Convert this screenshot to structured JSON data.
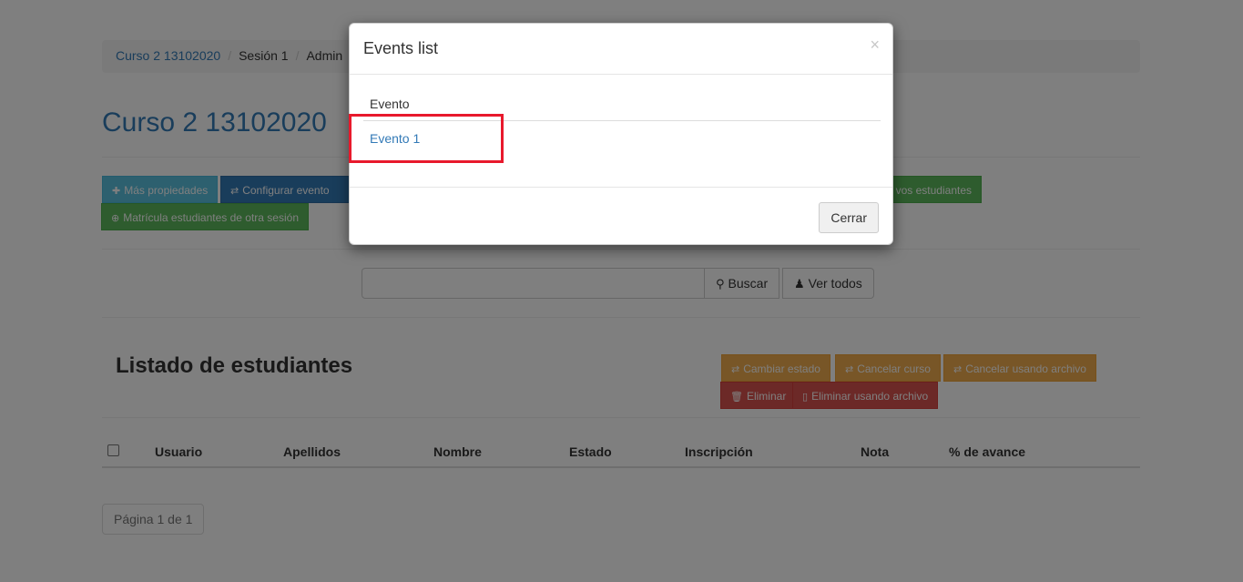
{
  "breadcrumb": {
    "course": "Curso 2 13102020",
    "session": "Sesión 1",
    "admin": "Admin"
  },
  "page_title": "Curso 2 13102020",
  "toolbar": {
    "more_props": "Más propiedades",
    "config_event": "Configurar evento",
    "new_students": "vos estudiantes",
    "enroll_other": "Matrícula estudiantes de otra sesión"
  },
  "search": {
    "value": "",
    "search_label": "Buscar",
    "view_all_label": "Ver todos"
  },
  "students": {
    "title": "Listado de estudiantes",
    "actions": {
      "change_state": "Cambiar estado",
      "cancel_course": "Cancelar curso",
      "cancel_file": "Cancelar usando archivo",
      "delete": "Eliminar",
      "delete_file": "Eliminar usando archivo"
    },
    "columns": [
      "Usuario",
      "Apellidos",
      "Nombre",
      "Estado",
      "Inscripción",
      "Nota",
      "% de avance"
    ],
    "pager": "Página 1 de 1"
  },
  "modal": {
    "title": "Events list",
    "close_symbol": "×",
    "column_header": "Evento",
    "events": [
      "Evento 1"
    ],
    "close_button": "Cerrar"
  },
  "colors": {
    "link": "#337ab7",
    "highlight": "#e8192c"
  }
}
